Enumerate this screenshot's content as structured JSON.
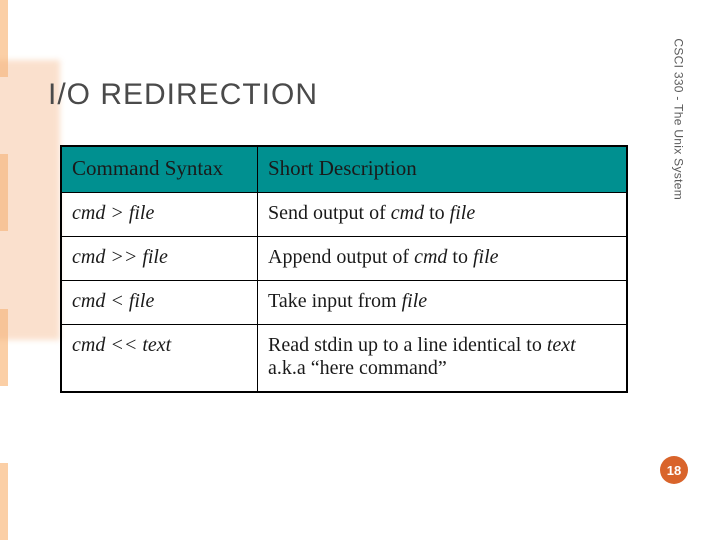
{
  "title": "I/O REDIRECTION",
  "side_label": "CSCI 330 - The Unix System",
  "page_number": "18",
  "table": {
    "headers": {
      "c0": "Command Syntax",
      "c1": "Short Description"
    },
    "rows": [
      {
        "syntax_pre": "cmd > file",
        "desc_pre": "Send output of ",
        "desc_it1": "cmd",
        "desc_mid": " to ",
        "desc_it2": "file",
        "desc_post": ""
      },
      {
        "syntax_pre": "cmd >> file",
        "desc_pre": "Append output of ",
        "desc_it1": "cmd",
        "desc_mid": " to ",
        "desc_it2": "file",
        "desc_post": ""
      },
      {
        "syntax_pre": "cmd < file",
        "desc_pre": "Take input from ",
        "desc_it1": "file",
        "desc_mid": "",
        "desc_it2": "",
        "desc_post": ""
      },
      {
        "syntax_pre": "cmd << text",
        "desc_pre": "Read stdin up to a line identical to ",
        "desc_it1": "text",
        "desc_mid": "",
        "desc_it2": "",
        "desc_post": " a.k.a “here command”"
      }
    ]
  }
}
